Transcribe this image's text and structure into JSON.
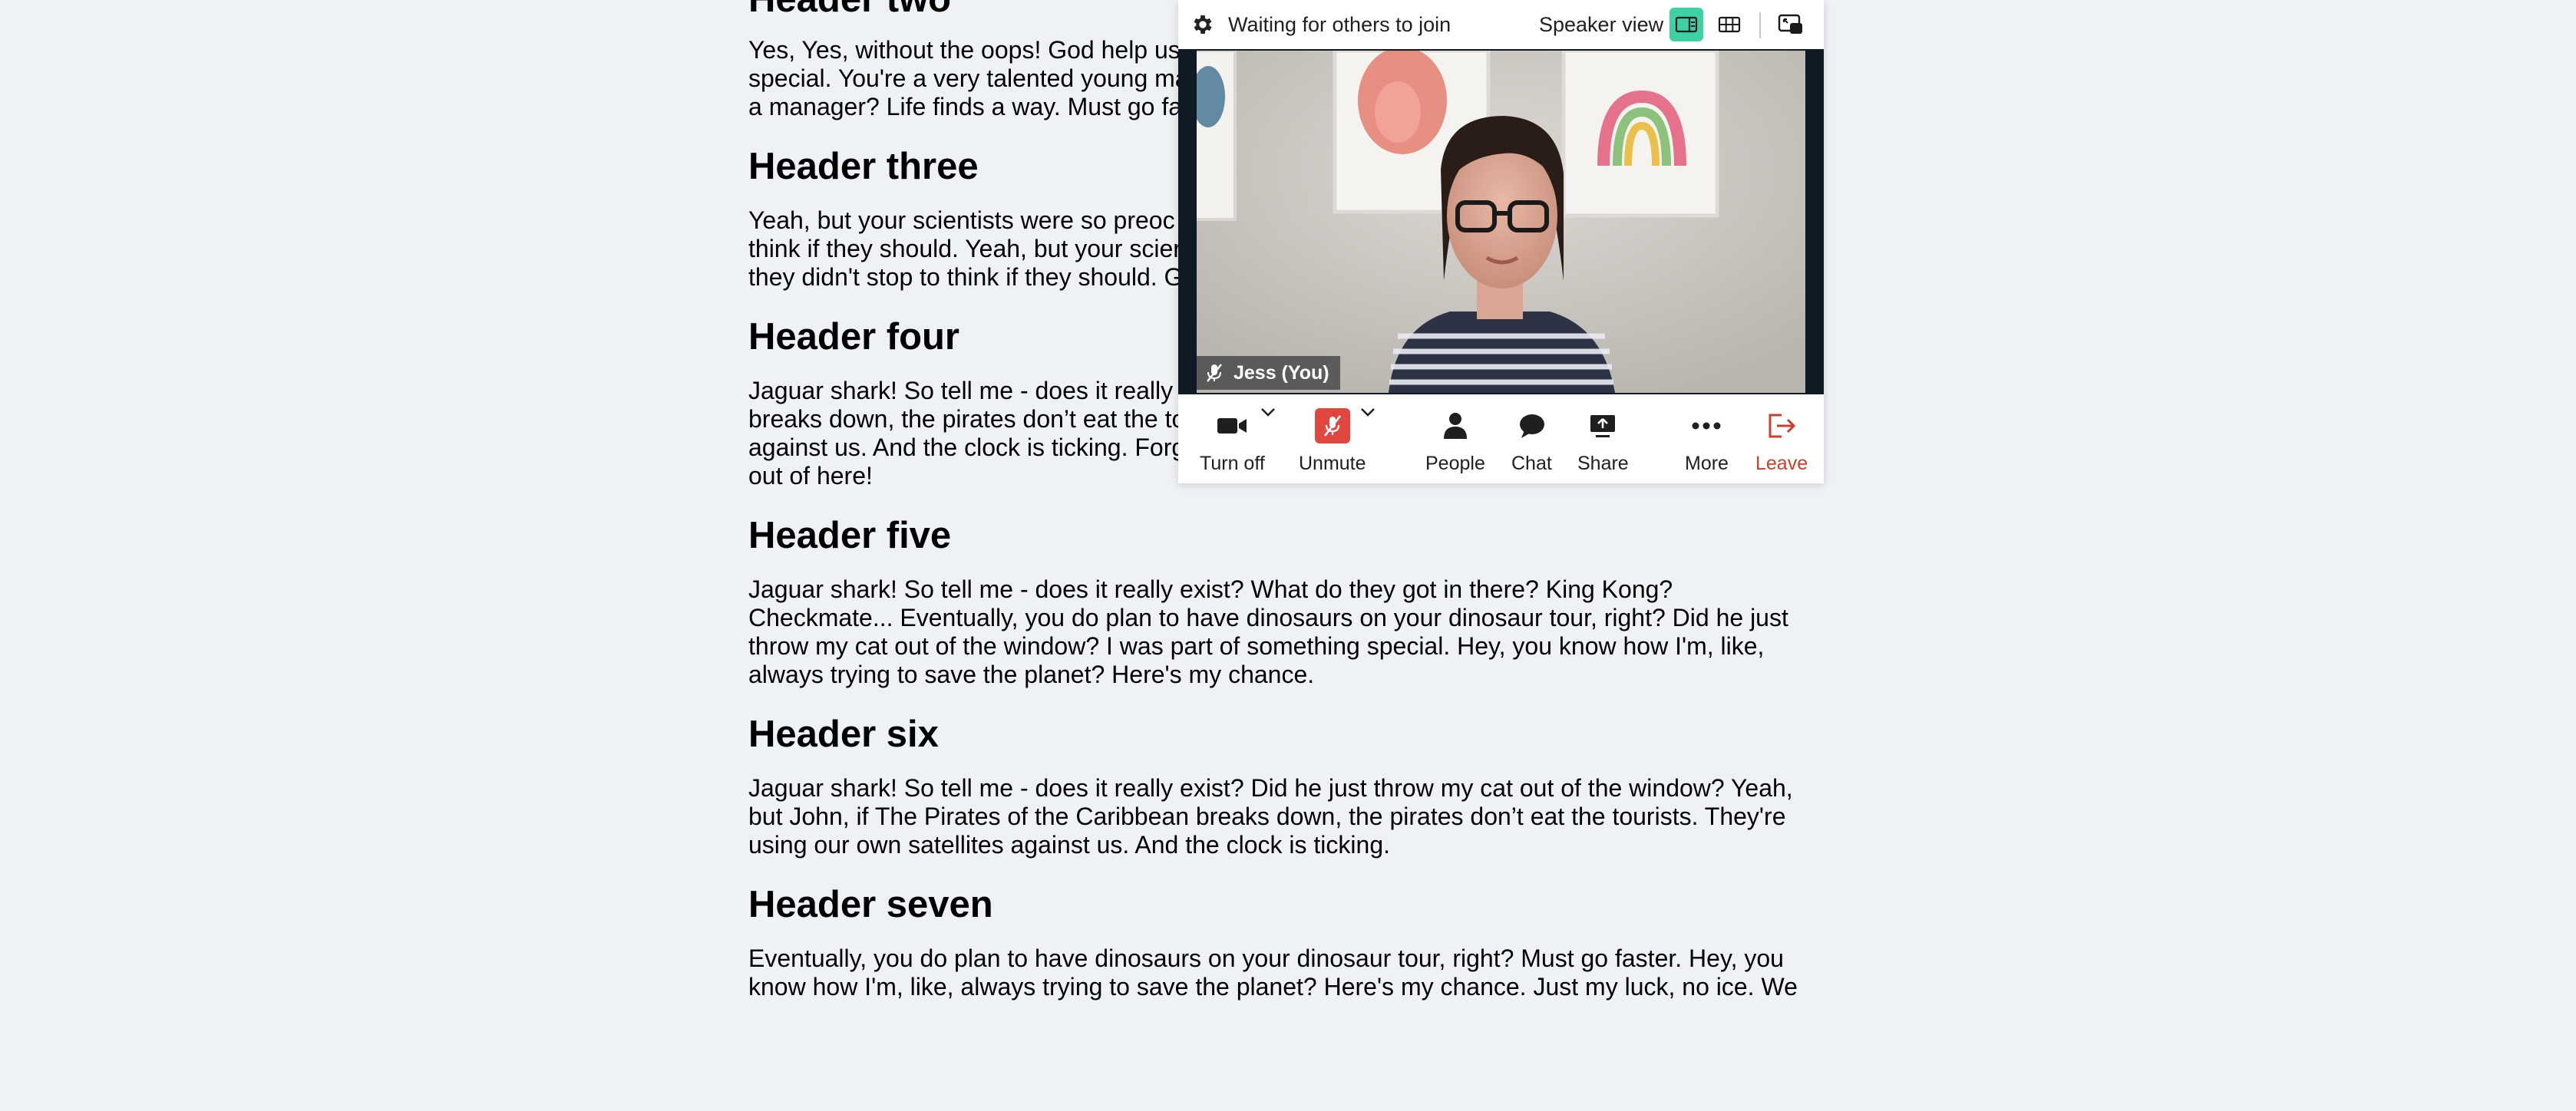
{
  "article": {
    "sections": [
      {
        "heading": "Header two",
        "lines": [
          "Yes, Yes, without the oops! God help us",
          "special. You're a very talented young ma",
          "a manager? Life finds a way. Must go fa"
        ]
      },
      {
        "heading": "Header three",
        "lines": [
          "Yeah, but your scientists were so preoc",
          "think if they should. Yeah, but your scier",
          "they didn't stop to think if they should. G"
        ]
      },
      {
        "heading": "Header four",
        "lines": [
          "Jaguar shark! So tell me - does it really",
          "breaks down, the pirates don’t eat the to",
          "against us. And the clock is ticking. Forget the fat lady! You're obsessed with the fat lady! Drive us",
          "out of here!"
        ]
      },
      {
        "heading": "Header five",
        "lines": [
          "Jaguar shark! So tell me - does it really exist? What do they got in there? King Kong?",
          "Checkmate... Eventually, you do plan to have dinosaurs on your dinosaur tour, right? Did he just",
          "throw my cat out of the window? I was part of something special. Hey, you know how I'm, like,",
          "always trying to save the planet? Here's my chance."
        ]
      },
      {
        "heading": "Header six",
        "lines": [
          "Jaguar shark! So tell me - does it really exist? Did he just throw my cat out of the window? Yeah,",
          "but John, if The Pirates of the Caribbean breaks down, the pirates don’t eat the tourists. They're",
          "using our own satellites against us. And the clock is ticking."
        ]
      },
      {
        "heading": "Header seven",
        "lines": [
          "Eventually, you do plan to have dinosaurs on your dinosaur tour, right? Must go faster. Hey, you",
          "know how I'm, like, always trying to save the planet? Here's my chance. Just my luck, no ice. We"
        ]
      }
    ]
  },
  "call": {
    "status": "Waiting for others to join",
    "view_label": "Speaker view",
    "participant_name": "Jess (You)",
    "toolbar": {
      "camera_label": "Turn off",
      "mic_label": "Unmute",
      "people_label": "People",
      "chat_label": "Chat",
      "share_label": "Share",
      "more_label": "More",
      "leave_label": "Leave"
    },
    "colors": {
      "accent": "#3fd1a4",
      "mic_off": "#e0473f",
      "leave": "#d23c2a",
      "video_bg": "#0f1a24"
    }
  }
}
